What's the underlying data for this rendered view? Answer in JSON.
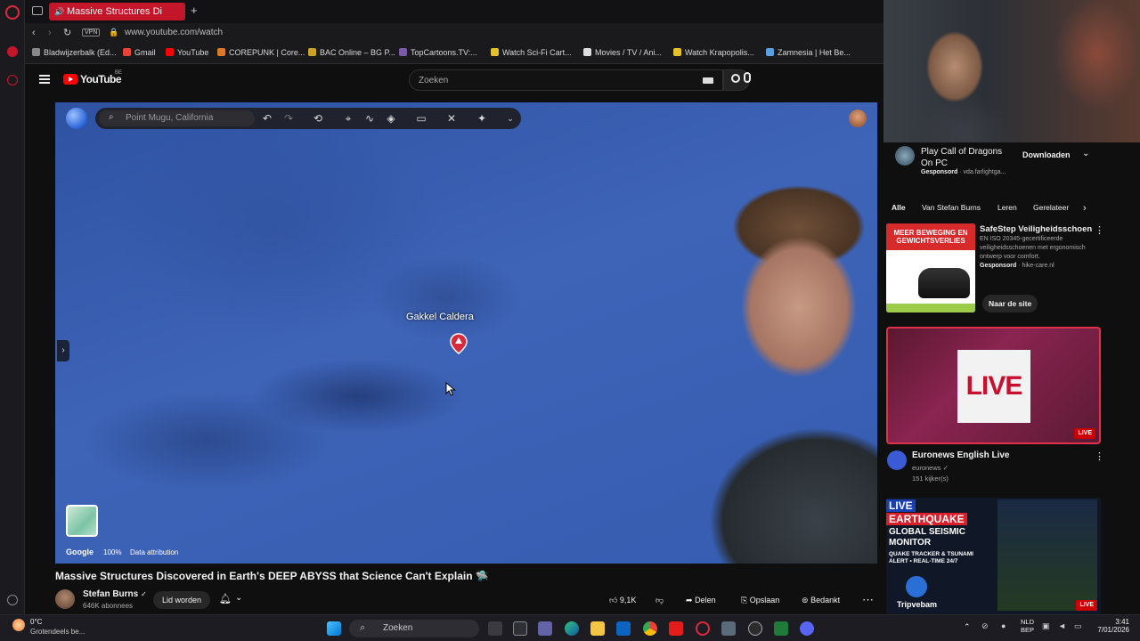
{
  "browser": {
    "tab_title": "Massive Structures Di",
    "url": "www.youtube.com/watch",
    "bookmarks": [
      "Bladwijzerbalk (Ed...",
      "Gmail",
      "YouTube",
      "COREPUNK | Core...",
      "BAC Online – BG P...",
      "TopCartoons.TV:...",
      "Watch Sci-Fi Cart...",
      "Movies / TV / Ani...",
      "Watch Krapopolis...",
      "Zamnesia | Het Be..."
    ],
    "vpn_label": "VPN"
  },
  "youtube": {
    "logo_text": "YouTube",
    "region": "BE",
    "search_placeholder": "Zoeken"
  },
  "video": {
    "earth_search_placeholder": "Point Mugu, California",
    "place_label": "Gakkel Caldera",
    "attribution": {
      "brand": "Google",
      "zoom": "100%",
      "data": "Data attribution"
    },
    "title": "Massive Structures Discovered in Earth's DEEP ABYSS that Science Can't Explain 🛸",
    "channel": "Stefan Burns",
    "subscribers": "646K abonnees",
    "join_label": "Lid worden",
    "likes": "9,1K",
    "share_label": "Delen",
    "save_label": "Opslaan",
    "thanks_label": "Bedankt"
  },
  "sidebar": {
    "top_ad": {
      "title": "Play Call of Dragons On PC",
      "sponsored": "Gesponsord",
      "domain": "· vda.farlightga...",
      "download_label": "Downloaden"
    },
    "chips": [
      "Alle",
      "Van Stefan Burns",
      "Leren",
      "Gerelateer"
    ],
    "ad2": {
      "title": "SafeStep Veiligheidsschoen",
      "desc": "EN ISO 20345-gecertificeerde veiligheidsschoenen met ergonomisch ontwerp voor comfort.",
      "sponsored": "Gesponsord",
      "domain": "· hike-care.nl",
      "thumb_headline": "MEER BEWEGING EN GEWICHTSVERLIES",
      "cta": "Naar de site"
    },
    "live_video": {
      "thumb_text": "LIVE",
      "title": "Euronews English Live",
      "channel": "euronews",
      "viewers": "151 kijker(s)",
      "badge": "LIVE"
    },
    "quake_video": {
      "line1": "LIVE",
      "line2": "EARTHQUAKE",
      "line3": "GLOBAL SEISMIC MONITOR",
      "line4": "QUAKE TRACKER & TSUNAMI ALERT • REAL-TIME 24/7",
      "brand": "Tripvebam",
      "badge": "LIVE"
    }
  },
  "taskbar": {
    "weather_temp": "0°C",
    "weather_desc": "Grotendeels be...",
    "search_label": "Zoeken",
    "lang_top": "NLD",
    "lang_bottom": "BEP",
    "time": "3:41",
    "date": "7/01/2026"
  },
  "colors": {
    "accent": "#c4162a",
    "youtube_red": "#ff0000",
    "background": "#0f0f0f",
    "ocean": "#3a62b5"
  }
}
